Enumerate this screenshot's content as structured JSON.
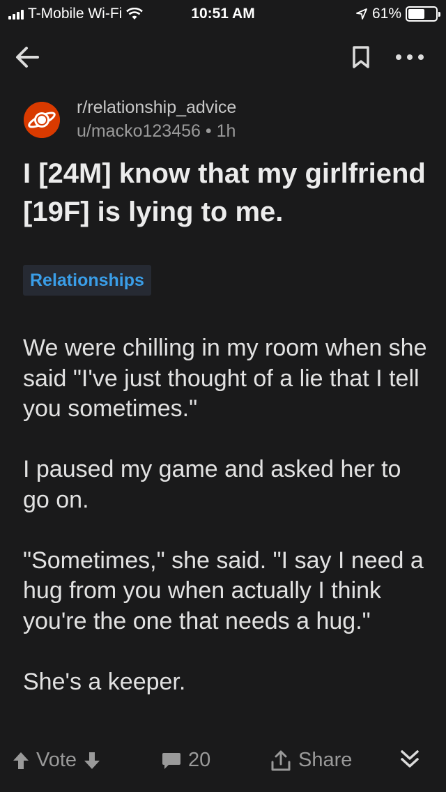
{
  "status_bar": {
    "carrier": "T-Mobile Wi-Fi",
    "time": "10:51 AM",
    "battery_percent": "61%",
    "battery_level": 0.61
  },
  "nav": {
    "back_icon": "arrow-left-icon",
    "bookmark_icon": "bookmark-icon",
    "more_icon": "more-horizontal-icon"
  },
  "post": {
    "subreddit": "r/relationship_advice",
    "author": "u/macko123456",
    "age": "1h",
    "separator": "•",
    "title": "I [24M] know that my girlfriend [19F] is lying to me.",
    "flair": "Relationships",
    "paragraphs": [
      "We were chilling in my room when she said \"I've just thought of a lie that I tell you sometimes.\"",
      "I paused my game and asked her to go on.",
      "\"Sometimes,\" she said. \"I say I need a hug from you when actually I think you're the one that needs a hug.\"",
      "She's a keeper."
    ]
  },
  "actions": {
    "vote_label": "Vote",
    "comment_count": "20",
    "share_label": "Share"
  },
  "colors": {
    "background": "#1a1a1b",
    "flair_text": "#3a9ee8",
    "avatar": "#d93a00"
  }
}
